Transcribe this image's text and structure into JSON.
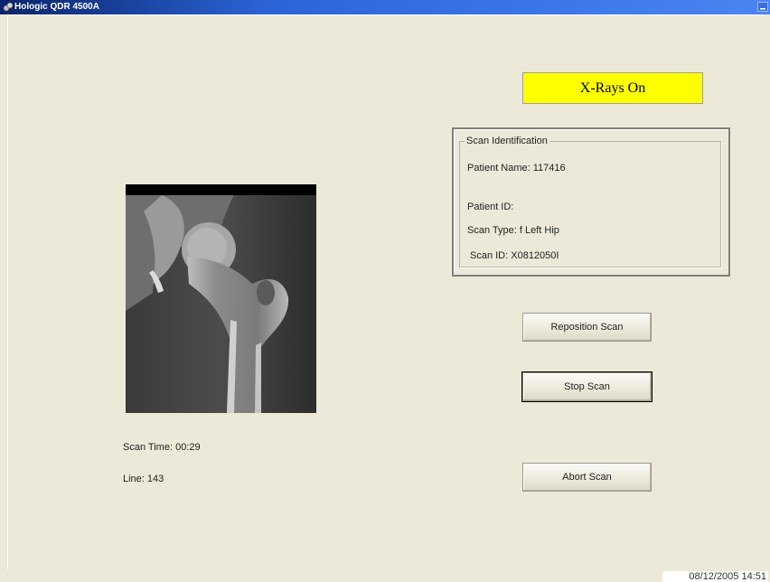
{
  "window": {
    "title": "Hologic QDR 4500A"
  },
  "status": {
    "xray_indicator": "X-Rays On"
  },
  "scan_identification": {
    "group_label": "Scan Identification",
    "patient_name": "Patient Name:  117416",
    "patient_id": "Patient ID:",
    "scan_type": "Scan Type:  f Left Hip",
    "scan_id": "Scan ID:  X0812050I"
  },
  "buttons": {
    "reposition": "Reposition Scan",
    "stop": "Stop Scan",
    "abort": "Abort Scan"
  },
  "scan_progress": {
    "scan_time": "Scan Time:  00:29",
    "line": "Line:  143"
  },
  "footer": {
    "timestamp": "08/12/2005 14:51"
  },
  "icons": {
    "app": "hologic-app-icon",
    "title_button": "minimize-icon"
  },
  "colors": {
    "titlebar": "#2b64d8",
    "xray_indicator": "#ffff00",
    "background": "#ece9d8"
  }
}
